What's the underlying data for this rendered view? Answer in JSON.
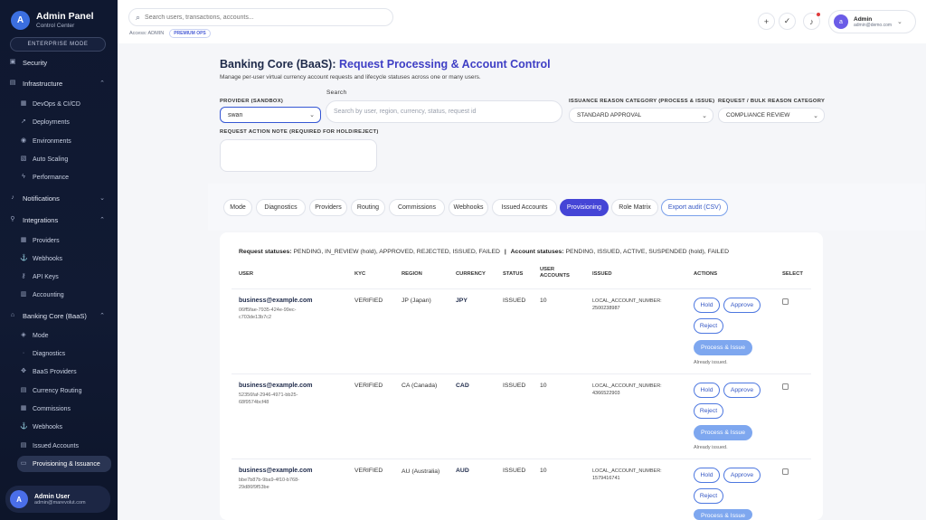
{
  "brand": {
    "title": "Admin Panel",
    "subtitle": "Control Center",
    "logo": "A",
    "mode": "ENTERPRISE MODE"
  },
  "sidebar": {
    "items": [
      {
        "label": "Security",
        "icon": "shield-icon",
        "level": "top"
      },
      {
        "label": "Infrastructure",
        "icon": "server-icon",
        "level": "top",
        "expanded": true
      },
      {
        "label": "DevOps & CI/CD",
        "icon": "pipeline-icon",
        "level": "sub"
      },
      {
        "label": "Deployments",
        "icon": "rocket-icon",
        "level": "sub"
      },
      {
        "label": "Environments",
        "icon": "globe-icon",
        "level": "sub"
      },
      {
        "label": "Auto Scaling",
        "icon": "scale-icon",
        "level": "sub"
      },
      {
        "label": "Performance",
        "icon": "bolt-icon",
        "level": "sub"
      },
      {
        "label": "Notifications",
        "icon": "bell-icon",
        "level": "top",
        "expanded": false
      },
      {
        "label": "Integrations",
        "icon": "plug-icon",
        "level": "top",
        "expanded": true
      },
      {
        "label": "Providers",
        "icon": "grid-icon",
        "level": "sub"
      },
      {
        "label": "Webhooks",
        "icon": "webhook-icon",
        "level": "sub"
      },
      {
        "label": "API Keys",
        "icon": "key-icon",
        "level": "sub"
      },
      {
        "label": "Accounting",
        "icon": "ledger-icon",
        "level": "sub"
      },
      {
        "label": "Banking Core (BaaS)",
        "icon": "bank-icon",
        "level": "top",
        "expanded": true
      },
      {
        "label": "Mode",
        "icon": "toggle-icon",
        "level": "sub"
      },
      {
        "label": "Diagnostics",
        "icon": "pulse-icon",
        "level": "sub"
      },
      {
        "label": "BaaS Providers",
        "icon": "puzzle-icon",
        "level": "sub"
      },
      {
        "label": "Currency Routing",
        "icon": "route-icon",
        "level": "sub"
      },
      {
        "label": "Commissions",
        "icon": "percent-icon",
        "level": "sub"
      },
      {
        "label": "Webhooks",
        "icon": "webhook-icon",
        "level": "sub"
      },
      {
        "label": "Issued Accounts",
        "icon": "list-icon",
        "level": "sub"
      },
      {
        "label": "Provisioning & Issuance",
        "icon": "card-icon",
        "level": "sub",
        "active": true
      }
    ],
    "user": {
      "initial": "A",
      "name": "Admin User",
      "email": "admin@marevolut.com"
    }
  },
  "topbar": {
    "search_placeholder": "Search users, transactions, accounts...",
    "access_label": "Access: ADMIN",
    "access_badge": "PREMIUM OPS",
    "admin": {
      "initial": "a",
      "name": "Admin",
      "email": "admin@demo.com"
    }
  },
  "page": {
    "title_part1": "Banking Core (BaaS):",
    "title_part2": "Request Processing & Account Control",
    "description": "Manage per-user virtual currency account requests and lifecycle statuses across one or many users.",
    "provider_label": "PROVIDER (SANDBOX)",
    "provider_value": "swan",
    "search_label": "Search",
    "search_placeholder": "Search by user, region, currency, status, request id",
    "issuance_label": "ISSUANCE REASON CATEGORY (PROCESS & ISSUE)",
    "issuance_value": "STANDARD APPROVAL",
    "bulk_label": "REQUEST / BULK REASON CATEGORY",
    "bulk_value": "COMPLIANCE REVIEW",
    "note_label": "REQUEST ACTION NOTE (REQUIRED FOR HOLD/REJECT)",
    "note_value": ""
  },
  "tabs": [
    "Mode",
    "Diagnostics",
    "Providers",
    "Routing",
    "Commissions",
    "Webhooks",
    "Issued Accounts",
    "Provisioning",
    "Role Matrix",
    "Export audit (CSV)"
  ],
  "active_tab": "Provisioning",
  "statuses": {
    "request_label": "Request statuses:",
    "request_values": "PENDING, IN_REVIEW (hold), APPROVED, REJECTED, ISSUED, FAILED",
    "sep": "|",
    "account_label": "Account statuses:",
    "account_values": "PENDING, ISSUED, ACTIVE, SUSPENDED (hold), FAILED"
  },
  "table": {
    "headers": {
      "user": "USER",
      "kyc": "KYC",
      "region": "REGION",
      "currency": "CURRENCY",
      "status": "STATUS",
      "user_accounts_1": "USER",
      "user_accounts_2": "ACCOUNTS",
      "issued": "ISSUED",
      "actions": "ACTIONS",
      "select": "SELECT"
    },
    "actions": {
      "hold": "Hold",
      "approve": "Approve",
      "reject": "Reject",
      "process": "Process & Issue",
      "done": "Already issued."
    },
    "rows": [
      {
        "email": "business@example.com",
        "uid": "06ff5fae-7935-424e-99ec-c703de13b7c2",
        "kyc": "VERIFIED",
        "region": "JP (Japan)",
        "currency": "JPY",
        "status": "ISSUED",
        "accounts": "10",
        "issued_label": "LOCAL_ACCOUNT_NUMBER:",
        "issued_value": "2500238987"
      },
      {
        "email": "business@example.com",
        "uid": "52356faf-2946-4971-bb25-68f9574bcf48",
        "kyc": "VERIFIED",
        "region": "CA (Canada)",
        "currency": "CAD",
        "status": "ISSUED",
        "accounts": "10",
        "issued_label": "LOCAL_ACCOUNT_NUMBER:",
        "issued_value": "4366522903"
      },
      {
        "email": "business@example.com",
        "uid": "bbe7b87b-9ba9-4f10-b768-29d86f9f53be",
        "kyc": "VERIFIED",
        "region": "AU (Australia)",
        "currency": "AUD",
        "status": "ISSUED",
        "accounts": "10",
        "issued_label": "LOCAL_ACCOUNT_NUMBER:",
        "issued_value": "1579416741"
      }
    ]
  },
  "colors": {
    "accent": "#4545d6",
    "sidebar_bg": "#0f1830",
    "primary_button": "#7ea7ef"
  }
}
